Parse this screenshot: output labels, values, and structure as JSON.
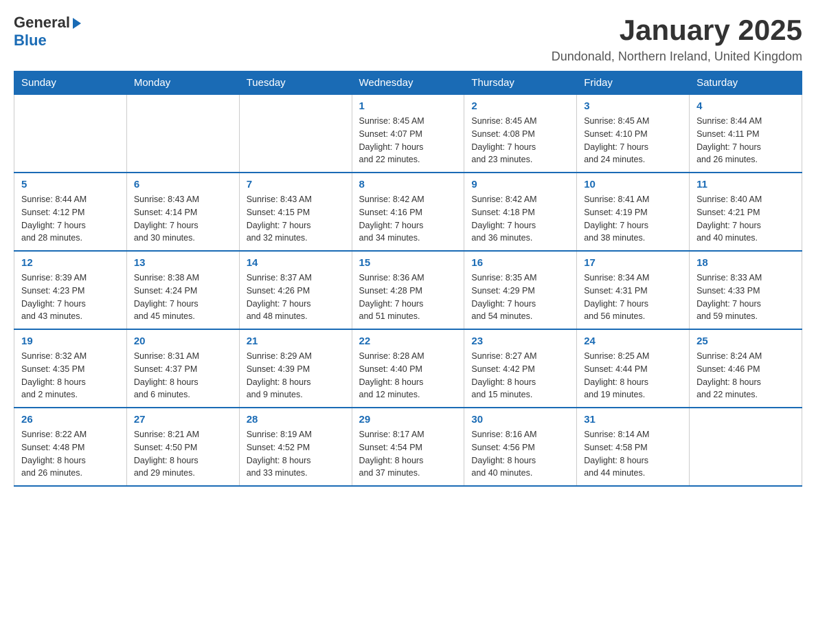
{
  "logo": {
    "general": "General",
    "blue": "Blue"
  },
  "title": "January 2025",
  "location": "Dundonald, Northern Ireland, United Kingdom",
  "weekdays": [
    "Sunday",
    "Monday",
    "Tuesday",
    "Wednesday",
    "Thursday",
    "Friday",
    "Saturday"
  ],
  "weeks": [
    [
      {
        "day": "",
        "info": ""
      },
      {
        "day": "",
        "info": ""
      },
      {
        "day": "",
        "info": ""
      },
      {
        "day": "1",
        "info": "Sunrise: 8:45 AM\nSunset: 4:07 PM\nDaylight: 7 hours\nand 22 minutes."
      },
      {
        "day": "2",
        "info": "Sunrise: 8:45 AM\nSunset: 4:08 PM\nDaylight: 7 hours\nand 23 minutes."
      },
      {
        "day": "3",
        "info": "Sunrise: 8:45 AM\nSunset: 4:10 PM\nDaylight: 7 hours\nand 24 minutes."
      },
      {
        "day": "4",
        "info": "Sunrise: 8:44 AM\nSunset: 4:11 PM\nDaylight: 7 hours\nand 26 minutes."
      }
    ],
    [
      {
        "day": "5",
        "info": "Sunrise: 8:44 AM\nSunset: 4:12 PM\nDaylight: 7 hours\nand 28 minutes."
      },
      {
        "day": "6",
        "info": "Sunrise: 8:43 AM\nSunset: 4:14 PM\nDaylight: 7 hours\nand 30 minutes."
      },
      {
        "day": "7",
        "info": "Sunrise: 8:43 AM\nSunset: 4:15 PM\nDaylight: 7 hours\nand 32 minutes."
      },
      {
        "day": "8",
        "info": "Sunrise: 8:42 AM\nSunset: 4:16 PM\nDaylight: 7 hours\nand 34 minutes."
      },
      {
        "day": "9",
        "info": "Sunrise: 8:42 AM\nSunset: 4:18 PM\nDaylight: 7 hours\nand 36 minutes."
      },
      {
        "day": "10",
        "info": "Sunrise: 8:41 AM\nSunset: 4:19 PM\nDaylight: 7 hours\nand 38 minutes."
      },
      {
        "day": "11",
        "info": "Sunrise: 8:40 AM\nSunset: 4:21 PM\nDaylight: 7 hours\nand 40 minutes."
      }
    ],
    [
      {
        "day": "12",
        "info": "Sunrise: 8:39 AM\nSunset: 4:23 PM\nDaylight: 7 hours\nand 43 minutes."
      },
      {
        "day": "13",
        "info": "Sunrise: 8:38 AM\nSunset: 4:24 PM\nDaylight: 7 hours\nand 45 minutes."
      },
      {
        "day": "14",
        "info": "Sunrise: 8:37 AM\nSunset: 4:26 PM\nDaylight: 7 hours\nand 48 minutes."
      },
      {
        "day": "15",
        "info": "Sunrise: 8:36 AM\nSunset: 4:28 PM\nDaylight: 7 hours\nand 51 minutes."
      },
      {
        "day": "16",
        "info": "Sunrise: 8:35 AM\nSunset: 4:29 PM\nDaylight: 7 hours\nand 54 minutes."
      },
      {
        "day": "17",
        "info": "Sunrise: 8:34 AM\nSunset: 4:31 PM\nDaylight: 7 hours\nand 56 minutes."
      },
      {
        "day": "18",
        "info": "Sunrise: 8:33 AM\nSunset: 4:33 PM\nDaylight: 7 hours\nand 59 minutes."
      }
    ],
    [
      {
        "day": "19",
        "info": "Sunrise: 8:32 AM\nSunset: 4:35 PM\nDaylight: 8 hours\nand 2 minutes."
      },
      {
        "day": "20",
        "info": "Sunrise: 8:31 AM\nSunset: 4:37 PM\nDaylight: 8 hours\nand 6 minutes."
      },
      {
        "day": "21",
        "info": "Sunrise: 8:29 AM\nSunset: 4:39 PM\nDaylight: 8 hours\nand 9 minutes."
      },
      {
        "day": "22",
        "info": "Sunrise: 8:28 AM\nSunset: 4:40 PM\nDaylight: 8 hours\nand 12 minutes."
      },
      {
        "day": "23",
        "info": "Sunrise: 8:27 AM\nSunset: 4:42 PM\nDaylight: 8 hours\nand 15 minutes."
      },
      {
        "day": "24",
        "info": "Sunrise: 8:25 AM\nSunset: 4:44 PM\nDaylight: 8 hours\nand 19 minutes."
      },
      {
        "day": "25",
        "info": "Sunrise: 8:24 AM\nSunset: 4:46 PM\nDaylight: 8 hours\nand 22 minutes."
      }
    ],
    [
      {
        "day": "26",
        "info": "Sunrise: 8:22 AM\nSunset: 4:48 PM\nDaylight: 8 hours\nand 26 minutes."
      },
      {
        "day": "27",
        "info": "Sunrise: 8:21 AM\nSunset: 4:50 PM\nDaylight: 8 hours\nand 29 minutes."
      },
      {
        "day": "28",
        "info": "Sunrise: 8:19 AM\nSunset: 4:52 PM\nDaylight: 8 hours\nand 33 minutes."
      },
      {
        "day": "29",
        "info": "Sunrise: 8:17 AM\nSunset: 4:54 PM\nDaylight: 8 hours\nand 37 minutes."
      },
      {
        "day": "30",
        "info": "Sunrise: 8:16 AM\nSunset: 4:56 PM\nDaylight: 8 hours\nand 40 minutes."
      },
      {
        "day": "31",
        "info": "Sunrise: 8:14 AM\nSunset: 4:58 PM\nDaylight: 8 hours\nand 44 minutes."
      },
      {
        "day": "",
        "info": ""
      }
    ]
  ]
}
